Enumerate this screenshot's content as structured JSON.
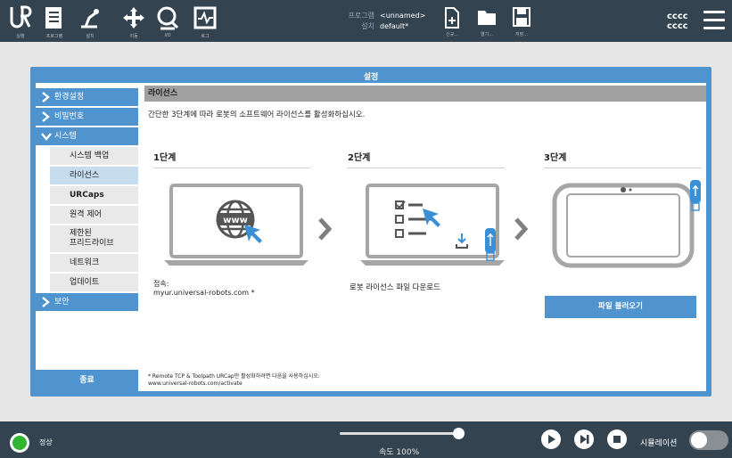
{
  "topbar": {
    "nav": [
      {
        "label": "실행",
        "icon": "ur-logo-icon"
      },
      {
        "label": "프로그램",
        "icon": "program-icon"
      },
      {
        "label": "설치",
        "icon": "installation-icon"
      },
      {
        "label": "이동",
        "icon": "move-icon"
      },
      {
        "label": "I/O",
        "icon": "io-icon"
      },
      {
        "label": "로그",
        "icon": "log-icon"
      }
    ],
    "program_key": "프로그램",
    "program_value": "<unnamed>",
    "install_key": "설치",
    "install_value": "default*",
    "file_buttons": [
      {
        "label": "신규...",
        "icon": "new-file-icon"
      },
      {
        "label": "열기...",
        "icon": "open-folder-icon"
      },
      {
        "label": "저장...",
        "icon": "save-icon"
      }
    ],
    "robot_name_line1": "cccc",
    "robot_name_line2": "cccc"
  },
  "dialog": {
    "title": "설정",
    "sidebar": {
      "items": [
        {
          "label": "환경설정",
          "expanded": false
        },
        {
          "label": "비밀번호",
          "expanded": false
        },
        {
          "label": "시스템",
          "expanded": true
        },
        {
          "label": "보안",
          "expanded": false
        }
      ],
      "system_sub": [
        {
          "label": "시스템 백업"
        },
        {
          "label": "라이선스",
          "active": true
        },
        {
          "label": "URCaps"
        },
        {
          "label": "원격 제어"
        },
        {
          "label": "제한된\n프리드라이브"
        },
        {
          "label": "네트워크"
        },
        {
          "label": "업데이트"
        }
      ],
      "exit_label": "종료"
    },
    "content": {
      "heading": "라이선스",
      "intro": "간단한 3단계에 따라 로봇의 소프트웨어 라이선스를 활성화하십시오.",
      "step1_title": "1단계",
      "step2_title": "2단계",
      "step3_title": "3단계",
      "step1_text_line1": "접속:",
      "step1_text_line2": "myur.universal-robots.com *",
      "step2_text": "로봇 라이선스 파일 다운로드",
      "www_text": "www",
      "load_button": "파일 불러오기",
      "footnote_line1": "* Remote TCP & Toolpath URCap만 활성화하려면 다음을 사용하십시오:",
      "footnote_line2": "www.universal-robots.com/activate"
    }
  },
  "bottombar": {
    "status_label": "정상",
    "speed_label": "속도 100%",
    "speed_percent": 100,
    "sim_label": "시뮬레이션",
    "simulation_on": false
  },
  "colors": {
    "topbar": "#33434f",
    "accent": "#4f93cf",
    "status_green": "#2fb52f"
  }
}
